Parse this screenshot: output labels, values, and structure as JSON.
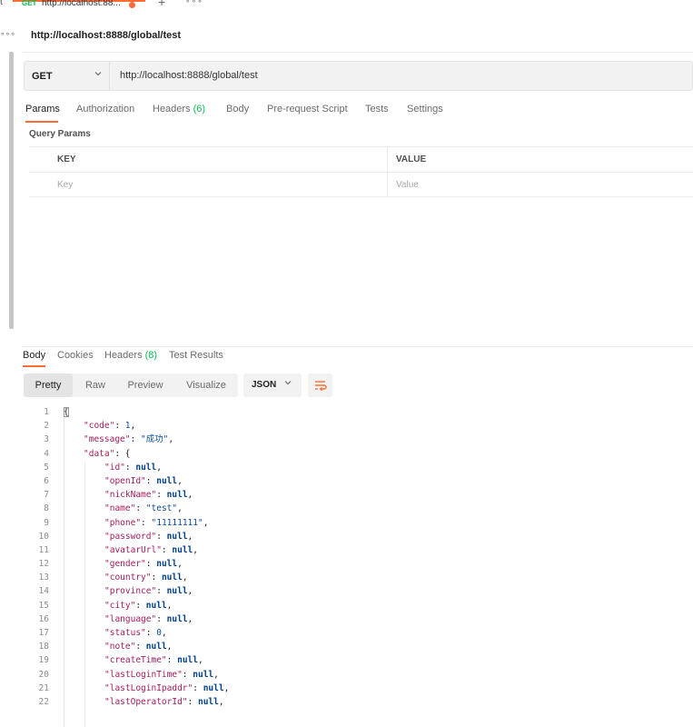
{
  "colors": {
    "accent": "#ff6c37",
    "method_get": "#0cbb52",
    "json_key": "#a41c5c",
    "json_value": "#0a4a9e"
  },
  "tabstrip": {
    "edge_text": "t",
    "tab": {
      "method": "GET",
      "title": "http://localhost:88...",
      "unsaved_icon": "unsaved-dot-icon"
    },
    "add_icon": "+",
    "more_icon": "∘∘∘"
  },
  "left_more_icon": "∘∘∘",
  "breadcrumb": "http://localhost:8888/global/test",
  "request": {
    "method": "GET",
    "url": "http://localhost:8888/global/test",
    "tabs": [
      {
        "label": "Params",
        "count": ""
      },
      {
        "label": "Authorization",
        "count": ""
      },
      {
        "label": "Headers",
        "count": "(6)"
      },
      {
        "label": "Body",
        "count": ""
      },
      {
        "label": "Pre-request Script",
        "count": ""
      },
      {
        "label": "Tests",
        "count": ""
      },
      {
        "label": "Settings",
        "count": ""
      }
    ],
    "query_params": {
      "title": "Query Params",
      "columns": [
        "KEY",
        "VALUE"
      ],
      "placeholders": {
        "key": "Key",
        "value": "Value"
      }
    }
  },
  "response": {
    "tabs": [
      {
        "label": "Body",
        "count": ""
      },
      {
        "label": "Cookies",
        "count": ""
      },
      {
        "label": "Headers",
        "count": "(8)"
      },
      {
        "label": "Test Results",
        "count": ""
      }
    ],
    "view_modes": [
      "Pretty",
      "Raw",
      "Preview",
      "Visualize"
    ],
    "format": "JSON",
    "wrap_icon": "wrap-lines-icon",
    "lines": [
      {
        "n": "1",
        "key": "",
        "value": "",
        "text": "{"
      },
      {
        "n": "2",
        "key": "\"code\"",
        "value": "1",
        "text": ","
      },
      {
        "n": "3",
        "key": "\"message\"",
        "value": "\"成功\"",
        "text": ","
      },
      {
        "n": "4",
        "key": "\"data\"",
        "value": "",
        "text": "{"
      },
      {
        "n": "5",
        "key": "\"id\"",
        "value": "null",
        "text": ","
      },
      {
        "n": "6",
        "key": "\"openId\"",
        "value": "null",
        "text": ","
      },
      {
        "n": "7",
        "key": "\"nickName\"",
        "value": "null",
        "text": ","
      },
      {
        "n": "8",
        "key": "\"name\"",
        "value": "\"test\"",
        "text": ","
      },
      {
        "n": "9",
        "key": "\"phone\"",
        "value": "\"11111111\"",
        "text": ","
      },
      {
        "n": "10",
        "key": "\"password\"",
        "value": "null",
        "text": ","
      },
      {
        "n": "11",
        "key": "\"avatarUrl\"",
        "value": "null",
        "text": ","
      },
      {
        "n": "12",
        "key": "\"gender\"",
        "value": "null",
        "text": ","
      },
      {
        "n": "13",
        "key": "\"country\"",
        "value": "null",
        "text": ","
      },
      {
        "n": "14",
        "key": "\"province\"",
        "value": "null",
        "text": ","
      },
      {
        "n": "15",
        "key": "\"city\"",
        "value": "null",
        "text": ","
      },
      {
        "n": "16",
        "key": "\"language\"",
        "value": "null",
        "text": ","
      },
      {
        "n": "17",
        "key": "\"status\"",
        "value": "0",
        "text": ","
      },
      {
        "n": "18",
        "key": "\"note\"",
        "value": "null",
        "text": ","
      },
      {
        "n": "19",
        "key": "\"createTime\"",
        "value": "null",
        "text": ","
      },
      {
        "n": "20",
        "key": "\"lastLoginTime\"",
        "value": "null",
        "text": ","
      },
      {
        "n": "21",
        "key": "\"lastLoginIpaddr\"",
        "value": "null",
        "text": ","
      },
      {
        "n": "22",
        "key": "\"lastOperatorId\"",
        "value": "null",
        "text": ","
      }
    ]
  }
}
